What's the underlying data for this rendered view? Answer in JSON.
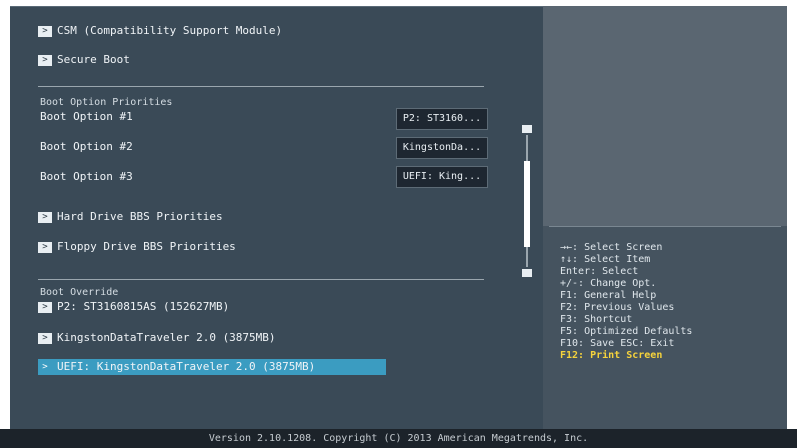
{
  "menu": {
    "csm": "CSM (Compatibility Support Module)",
    "secure_boot": "Secure Boot",
    "hdd_bbs": "Hard Drive BBS Priorities",
    "fdd_bbs": "Floppy Drive BBS Priorities"
  },
  "boot_priorities": {
    "title": "Boot Option Priorities",
    "options": [
      {
        "label": "Boot Option #1",
        "value": "P2: ST3160..."
      },
      {
        "label": "Boot Option #2",
        "value": "KingstonDa..."
      },
      {
        "label": "Boot Option #3",
        "value": "UEFI: King..."
      }
    ]
  },
  "boot_override": {
    "title": "Boot Override",
    "items": [
      "P2: ST3160815AS  (152627MB)",
      "KingstonDataTraveler 2.0  (3875MB)",
      "UEFI: KingstonDataTraveler 2.0 (3875MB)"
    ]
  },
  "help": {
    "lines": [
      "→←: Select Screen",
      "↑↓: Select Item",
      "Enter: Select",
      "+/-: Change Opt.",
      "F1: General Help",
      "F2: Previous Values",
      "F3: Shortcut",
      "F5: Optimized Defaults",
      "F10: Save  ESC: Exit",
      "F12: Print Screen"
    ]
  },
  "footer": "Version 2.10.1208. Copyright (C) 2013 American Megatrends, Inc.",
  "colors": {
    "accent": "#3b9cc1",
    "panel": "#3a4a57",
    "help_highlight": "#f6d33c"
  }
}
